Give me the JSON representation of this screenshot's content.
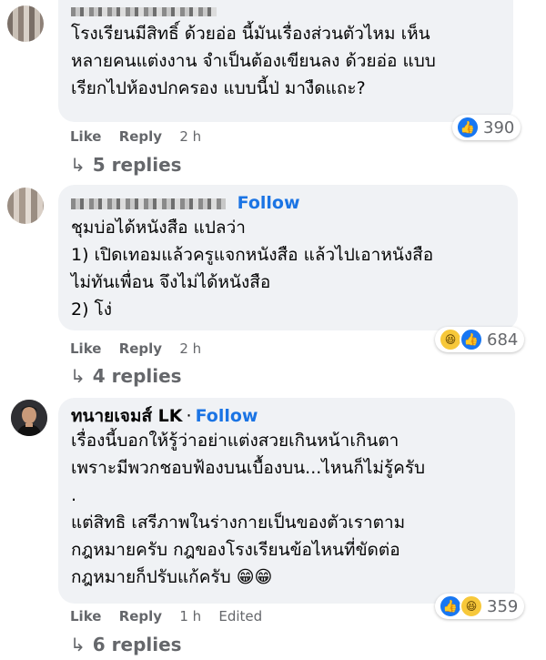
{
  "comments": [
    {
      "follow": "",
      "text": "โรงเรียนมีสิทธิ์ ด้วยอ่อ นี้มันเรื่องส่วนตัวไหม เห็น\nหลายคนแต่งงาน จำเป็นต้องเขียนลง ด้วยอ่อ แบบ\nเรียกไปห้องปกครอง แบบนี้ป่ มางืดแถะ?",
      "reaction_count": "390",
      "like": "Like",
      "reply": "Reply",
      "time": "2 h",
      "replies": "5 replies"
    },
    {
      "follow": "Follow",
      "text": "ชุมบ่อได้หนังสือ แปลว่า\n1) เปิดเทอมแล้วครูแจกหนังสือ แล้วไปเอาหนังสือ\nไม่ทันเพื่อน จึงไม่ได้หนังสือ\n2) โง่",
      "reaction_count": "684",
      "like": "Like",
      "reply": "Reply",
      "time": "2 h",
      "replies": "4 replies"
    },
    {
      "author": "ทนายเจมส์ LK",
      "follow": "Follow",
      "text": "เรื่องนี้บอกให้รู้ว่าอย่าแต่งสวยเกินหน้าเกินตา\nเพราะมีพวกชอบฟ้องบนเบื้องบน...ไหนก็ไม่รู้ครับ\n.\nแต่สิทธิ เสรีภาพในร่างกายเป็นของตัวเราตาม\nกฎหมายครับ กฎของโรงเรียนข้อไหนที่ขัดต่อ\nกฎหมายก็ปรับแก้ครับ 😁😁",
      "reaction_count": "359",
      "like": "Like",
      "reply": "Reply",
      "time": "1 h",
      "edited": "Edited",
      "replies": "6 replies"
    }
  ],
  "reaction_icons": {
    "like": "like-icon",
    "haha": "haha-icon"
  },
  "colors": {
    "accent": "#1b74e4",
    "bubble": "#f0f2f5",
    "muted": "#65676b"
  }
}
